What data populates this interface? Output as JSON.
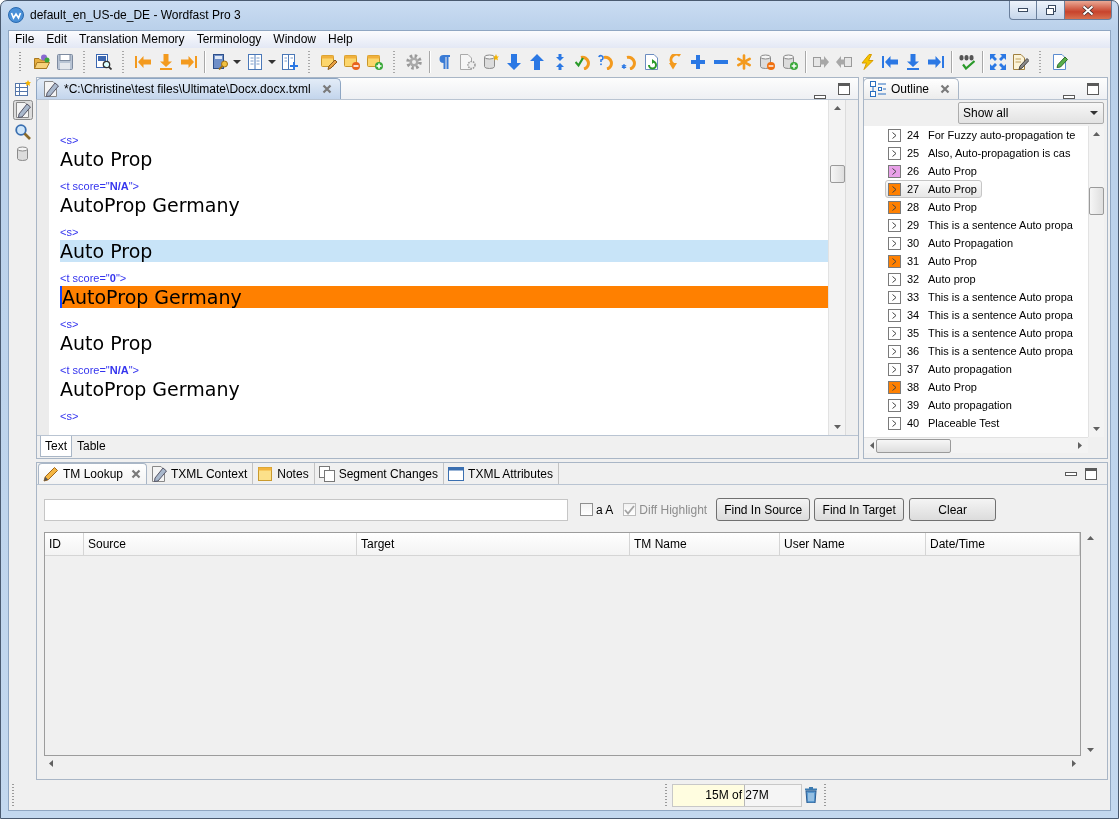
{
  "window": {
    "title": "default_en_US-de_DE - Wordfast Pro 3"
  },
  "menu": [
    "File",
    "Edit",
    "Translation Memory",
    "Terminology",
    "Window",
    "Help"
  ],
  "editor": {
    "tab": {
      "label": "*C:\\Christine\\test files\\Ultimate\\Docx.docx.txml",
      "active": true,
      "closable": true
    },
    "segments": [
      {
        "source_tag": "<s>",
        "source": "Auto Prop",
        "target_tag": "<t score=\"**N/A**\">",
        "target": "AutoProp Germany",
        "selected": false
      },
      {
        "source_tag": "<s>",
        "source": "Auto Prop",
        "target_tag": "<t score=\"**0**\">",
        "target": "AutoProp Germany",
        "selected": true
      },
      {
        "source_tag": "<s>",
        "source": "Auto Prop",
        "target_tag": "<t score=\"**N/A**\">",
        "target": "AutoProp Germany",
        "selected": false
      },
      {
        "source_tag": "<s>"
      }
    ],
    "view_tabs": [
      {
        "label": "Text",
        "selected": true
      },
      {
        "label": "Table",
        "selected": false
      }
    ]
  },
  "outline": {
    "tab": {
      "label": "Outline",
      "active": false,
      "closable": true
    },
    "filter": {
      "value": "Show all"
    },
    "items": [
      {
        "number": "24",
        "text": "For Fuzzy auto-propagation te",
        "color": "#ffffff",
        "selected": false
      },
      {
        "number": "25",
        "text": "Also, Auto-propagation is cas",
        "color": "#ffffff",
        "selected": false
      },
      {
        "number": "26",
        "text": "Auto Prop",
        "color": "#e8a0e8",
        "selected": false
      },
      {
        "number": "27",
        "text": "Auto Prop",
        "color": "#ff8000",
        "selected": true
      },
      {
        "number": "28",
        "text": "Auto Prop",
        "color": "#ff8000",
        "selected": false
      },
      {
        "number": "29",
        "text": "This is a sentence Auto propa",
        "color": "#ffffff",
        "selected": false
      },
      {
        "number": "30",
        "text": "Auto Propagation",
        "color": "#ffffff",
        "selected": false
      },
      {
        "number": "31",
        "text": "Auto Prop",
        "color": "#ff8000",
        "selected": false
      },
      {
        "number": "32",
        "text": "Auto prop",
        "color": "#ffffff",
        "selected": false
      },
      {
        "number": "33",
        "text": "This is a sentence Auto propa",
        "color": "#ffffff",
        "selected": false
      },
      {
        "number": "34",
        "text": "This is a sentence Auto propa",
        "color": "#ffffff",
        "selected": false
      },
      {
        "number": "35",
        "text": "This is a sentence Auto propa",
        "color": "#ffffff",
        "selected": false
      },
      {
        "number": "36",
        "text": "This is a sentence Auto propa",
        "color": "#ffffff",
        "selected": false
      },
      {
        "number": "37",
        "text": "Auto propagation",
        "color": "#ffffff",
        "selected": false
      },
      {
        "number": "38",
        "text": "Auto Prop",
        "color": "#ff8000",
        "selected": false
      },
      {
        "number": "39",
        "text": "Auto propagation",
        "color": "#ffffff",
        "selected": false
      },
      {
        "number": "40",
        "text": "Placeable Test",
        "color": "#ffffff",
        "selected": false
      }
    ]
  },
  "bottom_panel": {
    "tabs": [
      {
        "label": "TM Lookup",
        "selected": true,
        "closable": true
      },
      {
        "label": "TXML Context",
        "selected": false,
        "closable": false
      },
      {
        "label": "Notes",
        "selected": false,
        "closable": false
      },
      {
        "label": "Segment Changes",
        "selected": false,
        "closable": false
      },
      {
        "label": "TXML Attributes",
        "selected": false,
        "closable": false
      }
    ],
    "match_case": {
      "label": "a A",
      "checked": false,
      "disabled": false
    },
    "diff_highlight": {
      "label": "Diff Highlight",
      "checked": true,
      "disabled": true
    },
    "buttons": [
      "Find In Source",
      "Find In Target",
      "Clear"
    ],
    "table": {
      "columns": [
        "ID",
        "Source",
        "Target",
        "TM Name",
        "User Name",
        "Date/Time"
      ]
    }
  },
  "status_bar": {
    "memory": {
      "text": "15M of 27M",
      "level": 0.56
    }
  }
}
